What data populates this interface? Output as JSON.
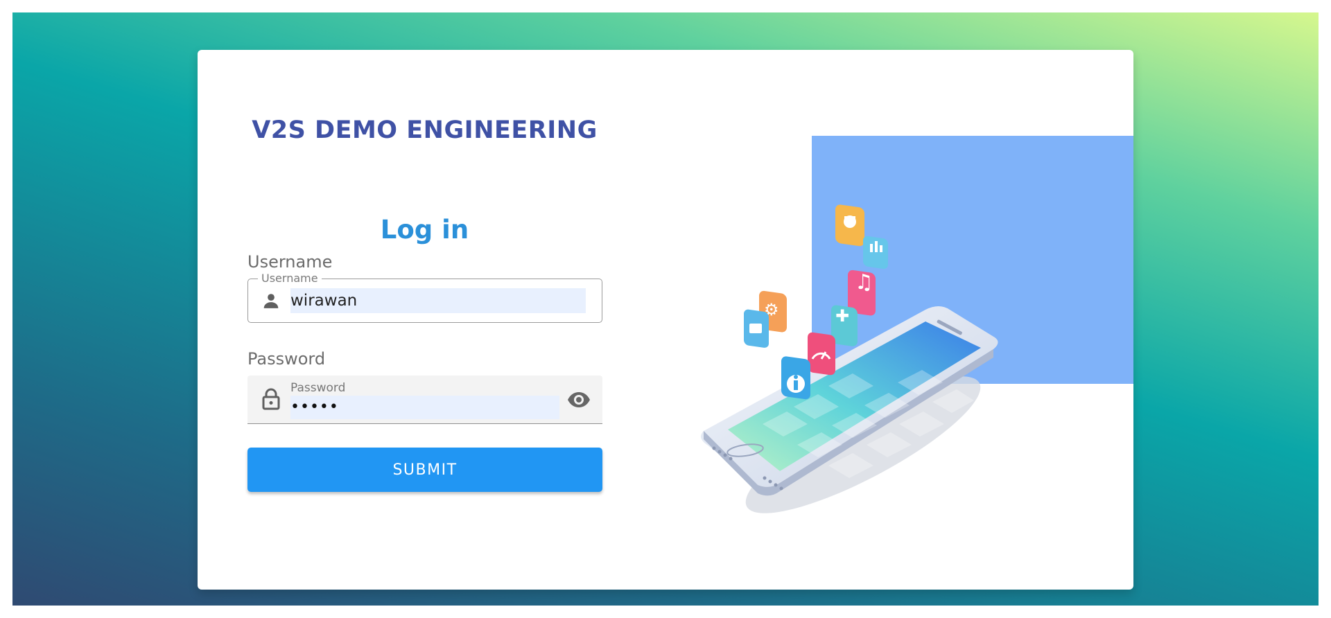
{
  "brand": {
    "title": "V2S DEMO ENGINEERING"
  },
  "login": {
    "heading": "Log in",
    "username": {
      "label": "Username",
      "legend": "Username",
      "value": "wirawan",
      "icon": "person-icon"
    },
    "password": {
      "label": "Password",
      "floating_label": "Password",
      "value": "•••••",
      "icon": "lock-icon",
      "toggle_icon": "eye-icon"
    },
    "submit_label": "SUBMIT"
  },
  "illustration": {
    "subject": "isometric-smartphone-with-app-icons",
    "panel_color": "#7fb2f9"
  },
  "colors": {
    "brand": "#3f51a5",
    "heading": "#2b90d9",
    "button": "#2196f3",
    "autofill": "#e8f0fe"
  }
}
